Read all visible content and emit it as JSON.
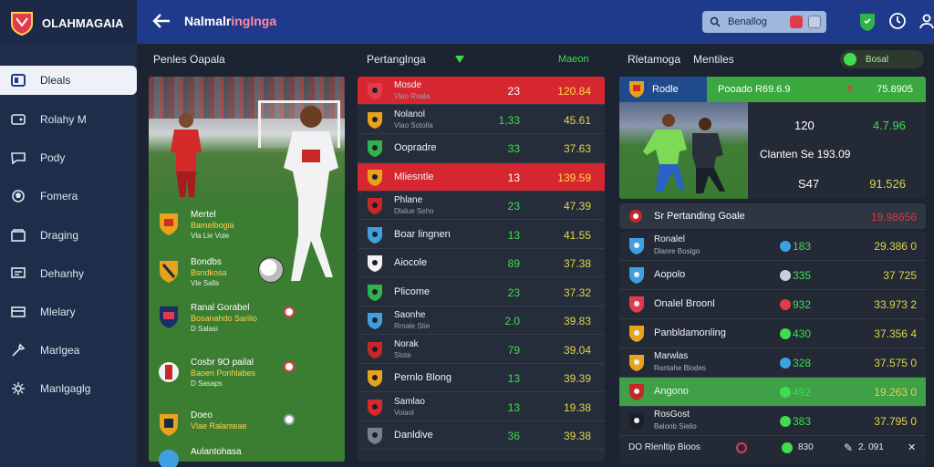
{
  "app": {
    "name": "OLAHMAGAIA"
  },
  "sidebar": {
    "items": [
      {
        "label": "Dleals",
        "icon": "dashboard-icon"
      },
      {
        "label": "Rolahy M",
        "icon": "wallet-icon"
      },
      {
        "label": "Pody",
        "icon": "message-icon"
      },
      {
        "label": "Fomera",
        "icon": "football-icon"
      },
      {
        "label": "Draging",
        "icon": "archive-icon"
      },
      {
        "label": "Dehanhy",
        "icon": "monitor-icon"
      },
      {
        "label": "Mlelary",
        "icon": "card-icon"
      },
      {
        "label": "Marlgea",
        "icon": "tools-icon"
      },
      {
        "label": "Manlgaglg",
        "icon": "settings-icon"
      }
    ]
  },
  "topbar": {
    "title": "Nalmalr",
    "title_highlight": "inglnga",
    "search_value": "Benallog"
  },
  "sections": {
    "left": "Penles Oapala",
    "middle": "Pertanglnga",
    "middle_extra": "Maeon",
    "right": "Rletamoga",
    "right_extra": "Mentiles",
    "toggle": "Bosal"
  },
  "photo_rows": [
    {
      "t1": "Mertel",
      "t2": "Bamelbogia",
      "t3": "Vla Lie Vole"
    },
    {
      "t1": "Bondbs",
      "t2": "Bsndkosa",
      "t3": "Vle Salls"
    },
    {
      "t1": "Ranal Gorabel",
      "t2": "Bosanahdo Sarilio",
      "t3": "D Salasi"
    },
    {
      "t1": "Cosbr 9O pailal",
      "t2": "Baoen Ponhlabes",
      "t3": "D Sasaps"
    },
    {
      "t1": "Doeo",
      "t2": "Vlae Ralanteae",
      "t3": ""
    },
    {
      "t1": "Aulantohasa",
      "t2": "",
      "t3": ""
    }
  ],
  "middle_rows": [
    {
      "name": "Mosde",
      "sub": "Vlao Roala",
      "v1": "23",
      "v2": "120.84",
      "red": true
    },
    {
      "name": "Nolanol",
      "sub": "Vlao Sotolla",
      "v1": "1,33",
      "v2": "45.61",
      "red": false
    },
    {
      "name": "Oopradre",
      "sub": "",
      "v1": "33",
      "v2": "37.63",
      "red": false
    },
    {
      "name": "Mliesntle",
      "sub": "",
      "v1": "13",
      "v2": "139.59",
      "red": true
    },
    {
      "name": "Phlane",
      "sub": "Dlalue Seho",
      "v1": "23",
      "v2": "47.39",
      "red": false
    },
    {
      "name": "Boar lingnen",
      "sub": "",
      "v1": "13",
      "v2": "41.55",
      "red": false
    },
    {
      "name": "Aiocole",
      "sub": "",
      "v1": "89",
      "v2": "37.38",
      "red": false
    },
    {
      "name": "Plicome",
      "sub": "",
      "v1": "23",
      "v2": "37.32",
      "red": false
    },
    {
      "name": "Saonhe",
      "sub": "Rmale Stie",
      "v1": "2.0",
      "v2": "39.83",
      "red": false
    },
    {
      "name": "Norak",
      "sub": "Stote",
      "v1": "79",
      "v2": "39.04",
      "red": false
    },
    {
      "name": "Pernlo Blong",
      "sub": "",
      "v1": "13",
      "v2": "39.39",
      "red": false
    },
    {
      "name": "Samlao",
      "sub": "Voiaol",
      "v1": "13",
      "v2": "19.38",
      "red": false
    },
    {
      "name": "Danldive",
      "sub": "",
      "v1": "36",
      "v2": "39.38",
      "red": false
    }
  ],
  "featured": {
    "team": "Rodle",
    "headline": "Pooado R69.6.9",
    "head_value": "75.8905",
    "a1": "120",
    "a2": "4.7.96",
    "b1": "Clanten Se 193.09",
    "c1": "S47",
    "c2": "91.526"
  },
  "right_header": {
    "label": "Sr Pertanding Goale",
    "value": "19.98656"
  },
  "right_rows": [
    {
      "name": "Ronalel",
      "sub": "Dlanre Bosigo",
      "v1": "183",
      "v2": "29.386 0",
      "ic": "#3fa0e0",
      "hl": false
    },
    {
      "name": "Aopolo",
      "sub": "",
      "v1": "335",
      "v2": "37 725",
      "ic": "#c8d0dc",
      "hl": false
    },
    {
      "name": "Onalel Broonl",
      "sub": "",
      "v1": "932",
      "v2": "33.973 2",
      "ic": "#e23c4c",
      "hl": false
    },
    {
      "name": "Panbldamonling",
      "sub": "",
      "v1": "430",
      "v2": "37.356 4",
      "ic": "#3fdc4e",
      "hl": false
    },
    {
      "name": "Marwlas",
      "sub": "Rantahe Blodes",
      "v1": "328",
      "v2": "37.575 0",
      "ic": "#3fa0e0",
      "hl": false
    },
    {
      "name": "Angono",
      "sub": "",
      "v1": "492",
      "v2": "19.263 0",
      "ic": "#3fdc4e",
      "hl": true
    },
    {
      "name": "RosGost",
      "sub": "Balonb Sielio",
      "v1": "383",
      "v2": "37.795 0",
      "ic": "#3fdc4e",
      "hl": false
    }
  ],
  "footer": {
    "a": "DO Rlenltip Bioos",
    "b": "830",
    "c": "2. 091"
  }
}
